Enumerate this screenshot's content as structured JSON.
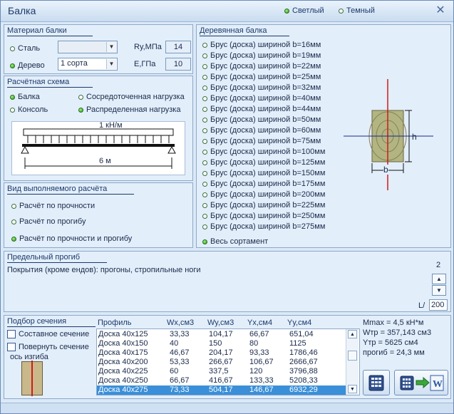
{
  "window": {
    "title": "Балка",
    "close_symbol": "✕"
  },
  "theme": {
    "light": "Светлый",
    "dark": "Темный"
  },
  "material": {
    "title": "Материал балки",
    "steel": "Сталь",
    "wood": "Дерево",
    "steel_value": "",
    "grade_value": "1 сорта",
    "ry_label": "Ry,МПа",
    "ry_value": "14",
    "e_label": "Е,ГПа",
    "e_value": "10"
  },
  "scheme": {
    "title": "Расчётная схема",
    "beam": "Балка",
    "console": "Консоль",
    "point_load": "Сосредоточенная нагрузка",
    "dist_load": "Распределенная нагрузка",
    "load_label": "1 кН/м",
    "span_label": "6 м"
  },
  "calc_type": {
    "title": "Вид выполняемого расчёта",
    "opt1": "Расчёт по прочности",
    "opt2": "Расчёт по прогибу",
    "opt3": "Расчёт по прочности и прогибу"
  },
  "wood_beam": {
    "title": "Деревянная балка",
    "options": [
      "Брус (доска) шириной b=16мм",
      "Брус (доска) шириной b=19мм",
      "Брус (доска) шириной b=22мм",
      "Брус (доска) шириной b=25мм",
      "Брус (доска) шириной b=32мм",
      "Брус (доска) шириной b=40мм",
      "Брус (доска) шириной b=44мм",
      "Брус (доска) шириной b=50мм",
      "Брус (доска) шириной b=60мм",
      "Брус (доска) шириной b=75мм",
      "Брус (доска) шириной b=100мм",
      "Брус (доска) шириной b=125мм",
      "Брус (доска) шириной b=150мм",
      "Брус (доска) шириной b=175мм",
      "Брус (доска) шириной b=200мм",
      "Брус (доска) шириной b=225мм",
      "Брус (доска) шириной b=250мм",
      "Брус (доска) шириной b=275мм"
    ],
    "all": "Весь сортамент",
    "dim_h": "h",
    "dim_b": "b"
  },
  "deflection": {
    "title": "Предельный прогиб",
    "text": "Покрытия (кроме ендов): прогоны, стропильные ноги",
    "value": "2",
    "ratio_label": "L/",
    "ratio_value": "200"
  },
  "section": {
    "title": "Подбор сечения",
    "composite": "Составное сечение",
    "rotate": "Повернуть сечение",
    "axis_label": "ось изгиба",
    "headers": [
      "Профиль",
      "Wx,см3",
      "Wy,см3",
      "Yx,см4",
      "Yy,см4"
    ],
    "rows": [
      [
        "Доска 40х125",
        "33,33",
        "104,17",
        "66,67",
        "651,04"
      ],
      [
        "Доска 40х150",
        "40",
        "150",
        "80",
        "1125"
      ],
      [
        "Доска 40х175",
        "46,67",
        "204,17",
        "93,33",
        "1786,46"
      ],
      [
        "Доска 40х200",
        "53,33",
        "266,67",
        "106,67",
        "2666,67"
      ],
      [
        "Доска 40х225",
        "60",
        "337,5",
        "120",
        "3796,88"
      ],
      [
        "Доска 40х250",
        "66,67",
        "416,67",
        "133,33",
        "5208,33"
      ],
      [
        "Доска 40х275",
        "73,33",
        "504,17",
        "146,67",
        "6932,29"
      ]
    ],
    "selected_index": 6
  },
  "results": {
    "mmax": "Mmax = 4,5 кН*м",
    "wtr": "Wтр = 357,143 см3",
    "ytr": "Yтр = 5625 см4",
    "deflection": "прогиб = 24,3 мм"
  },
  "colors": {
    "accent": "#3a8fd8",
    "radio_on": "#2d9a1e",
    "beam_axis": "#d01a1a"
  }
}
